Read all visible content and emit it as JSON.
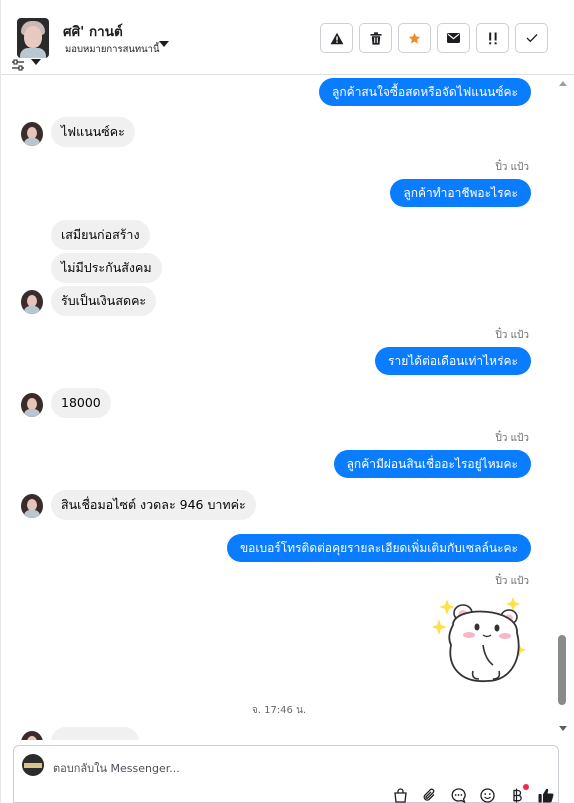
{
  "header": {
    "contact_name": "ศศิ' กานต์",
    "assign_label": "มอบหมายการสนทนานี้",
    "actions": [
      {
        "name": "spam-alert-icon",
        "label": "!"
      },
      {
        "name": "trash-icon",
        "label": ""
      },
      {
        "name": "star-icon",
        "label": ""
      },
      {
        "name": "mail-icon",
        "label": ""
      },
      {
        "name": "follow-up-icon",
        "label": "!"
      },
      {
        "name": "check-icon",
        "label": ""
      }
    ]
  },
  "messages": {
    "m1": "ลูกค้าสนใจซื้อสดหรือจัดไฟแนนซ์คะ",
    "m2": "ไฟแนนซ์คะ",
    "sender1": "ปิ๋ว แป้ว",
    "m3": "ลูกค้าทำอาชีพอะไรคะ",
    "m4": "เสมียนก่อสร้าง",
    "m5": "ไม่มีประกันสังคม",
    "m6": "รับเป็นเงินสดคะ",
    "sender2": "ปิ๋ว แป้ว",
    "m7": "รายได้ต่อเดือนเท่าไหร่คะ",
    "m8": "18000",
    "sender3": "ปิ๋ว แป้ว",
    "m9": "ลูกค้ามีผ่อนสินเชื่ออะไรอยู่ไหมคะ",
    "m10": "สินเชื่อมอไซต์ งวดละ 946 บาทค่ะ",
    "m11": "ขอเบอร์โทรติดต่อคุยรายละเอียดเพิ่มเติมกับเซลล์นะคะ",
    "sender4": "ปิ๋ว แป้ว",
    "timestamp": "จ. 17:46 น."
  },
  "composer": {
    "placeholder": "ตอบกลับใน Messenger..."
  },
  "colors": {
    "outgoing_bubble": "#0a7cff",
    "incoming_bubble": "#f0f0f0",
    "star": "#f28c28"
  }
}
